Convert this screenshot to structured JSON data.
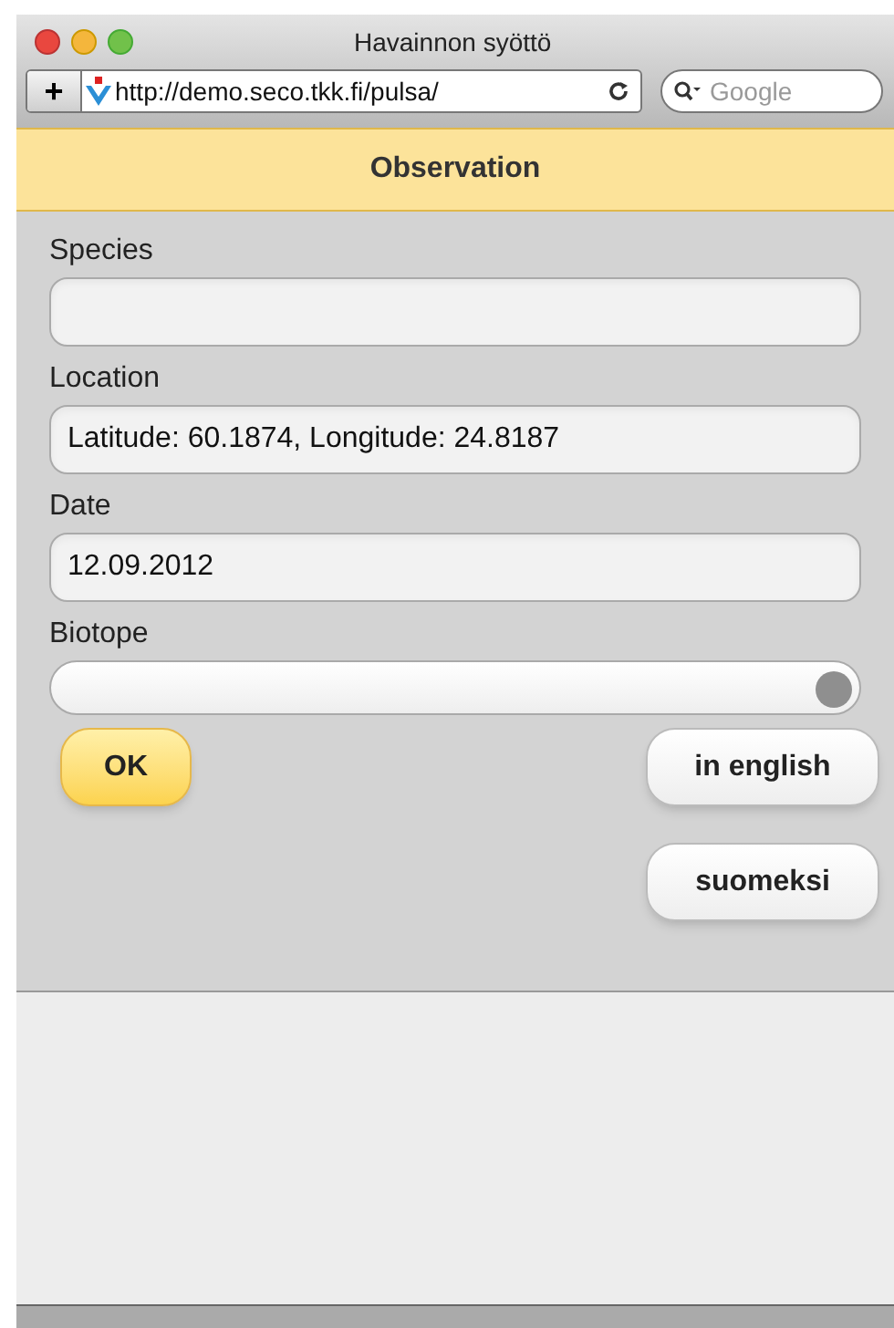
{
  "window": {
    "title": "Havainnon syöttö"
  },
  "toolbar": {
    "add": "+",
    "url": "http://demo.seco.tkk.fi/pulsa/",
    "search": {
      "placeholder": "Google"
    }
  },
  "header": {
    "title": "Observation"
  },
  "fields": [
    {
      "kind": "text",
      "label": "Species"
    },
    {
      "kind": "text",
      "label": "Location",
      "value": "Latitude: 60.1874, Longitude: 24.8187"
    },
    {
      "kind": "text",
      "label": "Date",
      "value": "12.09.2012"
    },
    {
      "kind": "slider",
      "label": "Biotope",
      "level": 1
    }
  ],
  "buttons": [
    {
      "label": "OK",
      "kind": "primary"
    },
    {
      "label": "in english",
      "kind": "plain"
    },
    {
      "label": "suomeksi",
      "kind": "plain"
    }
  ]
}
